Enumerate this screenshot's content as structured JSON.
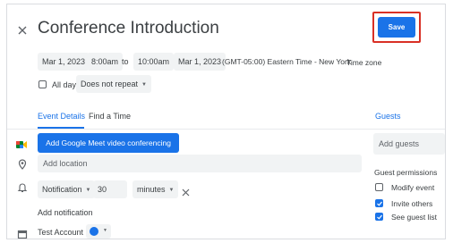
{
  "header": {
    "title": "Conference Introduction",
    "save_label": "Save"
  },
  "datetime": {
    "start_date": "Mar 1, 2023",
    "start_time": "8:00am",
    "to_label": "to",
    "end_time": "10:00am",
    "end_date": "Mar 1, 2023",
    "timezone": "(GMT-05:00) Eastern Time - New York",
    "timezone_link": "Time zone"
  },
  "options": {
    "all_day_label": "All day",
    "repeat_value": "Does not repeat"
  },
  "tabs": {
    "event_details": "Event Details",
    "find_a_time": "Find a Time",
    "guests": "Guests"
  },
  "details": {
    "meet_button": "Add Google Meet video conferencing",
    "location_placeholder": "Add location",
    "notification_type": "Notification",
    "notification_value": "30",
    "notification_unit": "minutes",
    "add_notification": "Add notification",
    "calendar_name": "Test Account"
  },
  "guests": {
    "add_placeholder": "Add guests",
    "permissions_title": "Guest permissions",
    "permissions": [
      {
        "label": "Modify event",
        "checked": false
      },
      {
        "label": "Invite others",
        "checked": true
      },
      {
        "label": "See guest list",
        "checked": true
      }
    ]
  },
  "colors": {
    "accent": "#1a73e8",
    "highlight_border": "#d93025",
    "calendar_dot": "#1a73e8"
  }
}
